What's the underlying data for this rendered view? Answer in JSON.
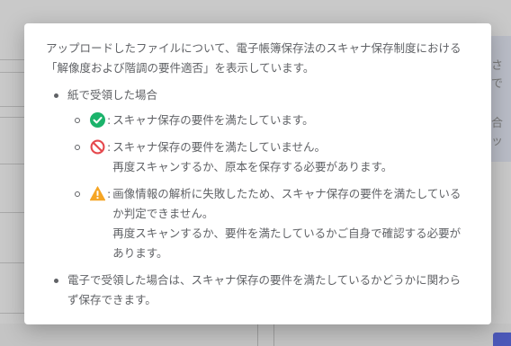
{
  "background": {
    "right_text": [
      "載さ",
      "てで",
      "場合",
      "エッ"
    ]
  },
  "modal": {
    "intro": "アップロードしたファイルについて、電子帳簿保存法のスキャナ保存制度における「解像度および階調の要件適否」を表示しています。",
    "paper_heading": "紙で受領した場合",
    "status_items": [
      {
        "icon": "check-circle-icon",
        "color": "#1bb36b",
        "lines": [
          "スキャナ保存の要件を満たしています。"
        ]
      },
      {
        "icon": "prohibited-icon",
        "color": "#e5484d",
        "lines": [
          "スキャナ保存の要件を満たしていません。",
          "再度スキャンするか、原本を保存する必要があります。"
        ]
      },
      {
        "icon": "warning-icon",
        "color": "#f5a524",
        "lines": [
          "画像情報の解析に失敗したため、スキャナ保存の要件を満たしているか判定できません。",
          "再度スキャンするか、要件を満たしているかご自身で確認する必要があります。"
        ]
      }
    ],
    "colon": ":",
    "electronic_text": "電子で受領した場合は、スキャナ保存の要件を満たしているかどうかに関わらず保存できます。"
  }
}
